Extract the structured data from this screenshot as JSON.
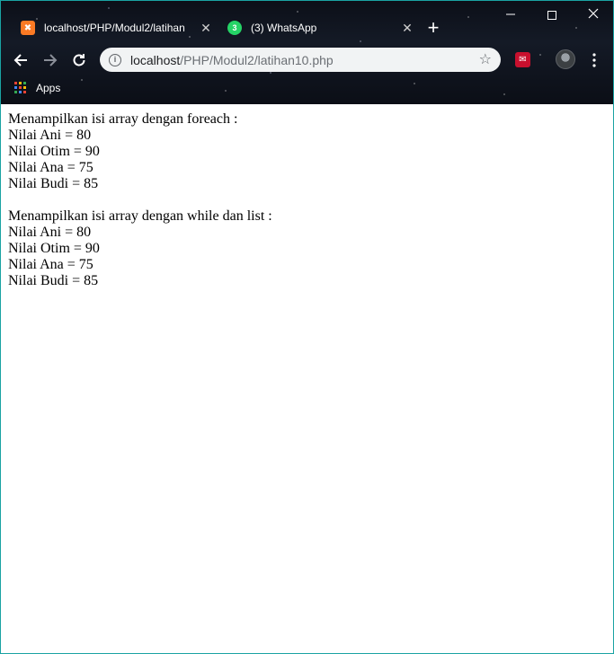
{
  "browser": {
    "tabs": [
      {
        "title": "localhost/PHP/Modul2/latihan",
        "favicon": "xampp-icon",
        "active": true
      },
      {
        "title": "(3) WhatsApp",
        "favicon": "whatsapp-icon",
        "badge": "3",
        "active": false
      }
    ],
    "tab_close_glyph": "✕",
    "new_tab_glyph": "+",
    "address": {
      "host": "localhost",
      "path": "/PHP/Modul2/latihan10.php"
    },
    "bookmarks": {
      "apps_label": "Apps"
    },
    "colors": {
      "frame_border": "#1aa3a3",
      "omnibox_bg": "#f1f3f4",
      "xampp_orange": "#fb7a24",
      "whatsapp_green": "#25d366"
    }
  },
  "page": {
    "section1": {
      "heading": "Menampilkan isi array dengan foreach :",
      "lines": [
        "Nilai Ani = 80",
        "Nilai Otim = 90",
        "Nilai Ana = 75",
        "Nilai Budi = 85"
      ]
    },
    "section2": {
      "heading": "Menampilkan isi array dengan while dan list :",
      "lines": [
        "Nilai Ani = 80",
        "Nilai Otim = 90",
        "Nilai Ana = 75",
        "Nilai Budi = 85"
      ]
    }
  }
}
